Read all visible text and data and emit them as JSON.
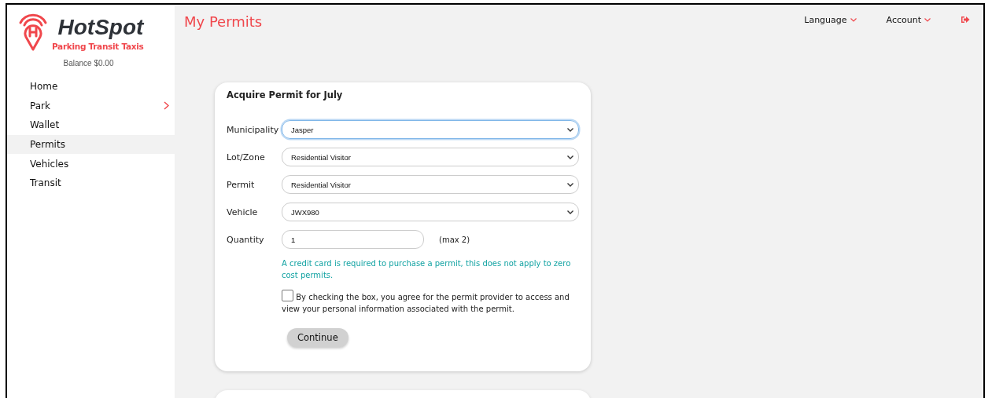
{
  "brand": {
    "name": "HotSpot",
    "tagline": "Parking Transit Taxis",
    "balance": "Balance $0.00"
  },
  "sidebar": {
    "items": [
      {
        "label": "Home",
        "selected": false,
        "has_submenu": false
      },
      {
        "label": "Park",
        "selected": false,
        "has_submenu": true
      },
      {
        "label": "Wallet",
        "selected": false,
        "has_submenu": false
      },
      {
        "label": "Permits",
        "selected": true,
        "has_submenu": false
      },
      {
        "label": "Vehicles",
        "selected": false,
        "has_submenu": false
      },
      {
        "label": "Transit",
        "selected": false,
        "has_submenu": false
      }
    ]
  },
  "page_title": "My Permits",
  "header": {
    "menus": [
      "Language",
      "Account"
    ]
  },
  "form": {
    "title": "Acquire Permit for July",
    "fields": [
      {
        "kind": "select",
        "label": "Municipality",
        "value": "Jasper",
        "focused": true
      },
      {
        "kind": "select",
        "label": "Lot/Zone",
        "value": "Residential Visitor",
        "focused": false
      },
      {
        "kind": "select",
        "label": "Permit",
        "value": "Residential Visitor",
        "focused": false
      },
      {
        "kind": "select",
        "label": "Vehicle",
        "value": "JWX980",
        "focused": false
      },
      {
        "kind": "input",
        "label": "Quantity",
        "value": "1",
        "focused": false,
        "hint": "(max 2)"
      }
    ],
    "notice": "A credit card is required to purchase a permit, this does not apply to zero cost permits.",
    "consent": {
      "checked": false,
      "text": "By checking the box, you agree for the permit provider to access and view your personal information associated with the permit."
    },
    "button": "Continue"
  }
}
